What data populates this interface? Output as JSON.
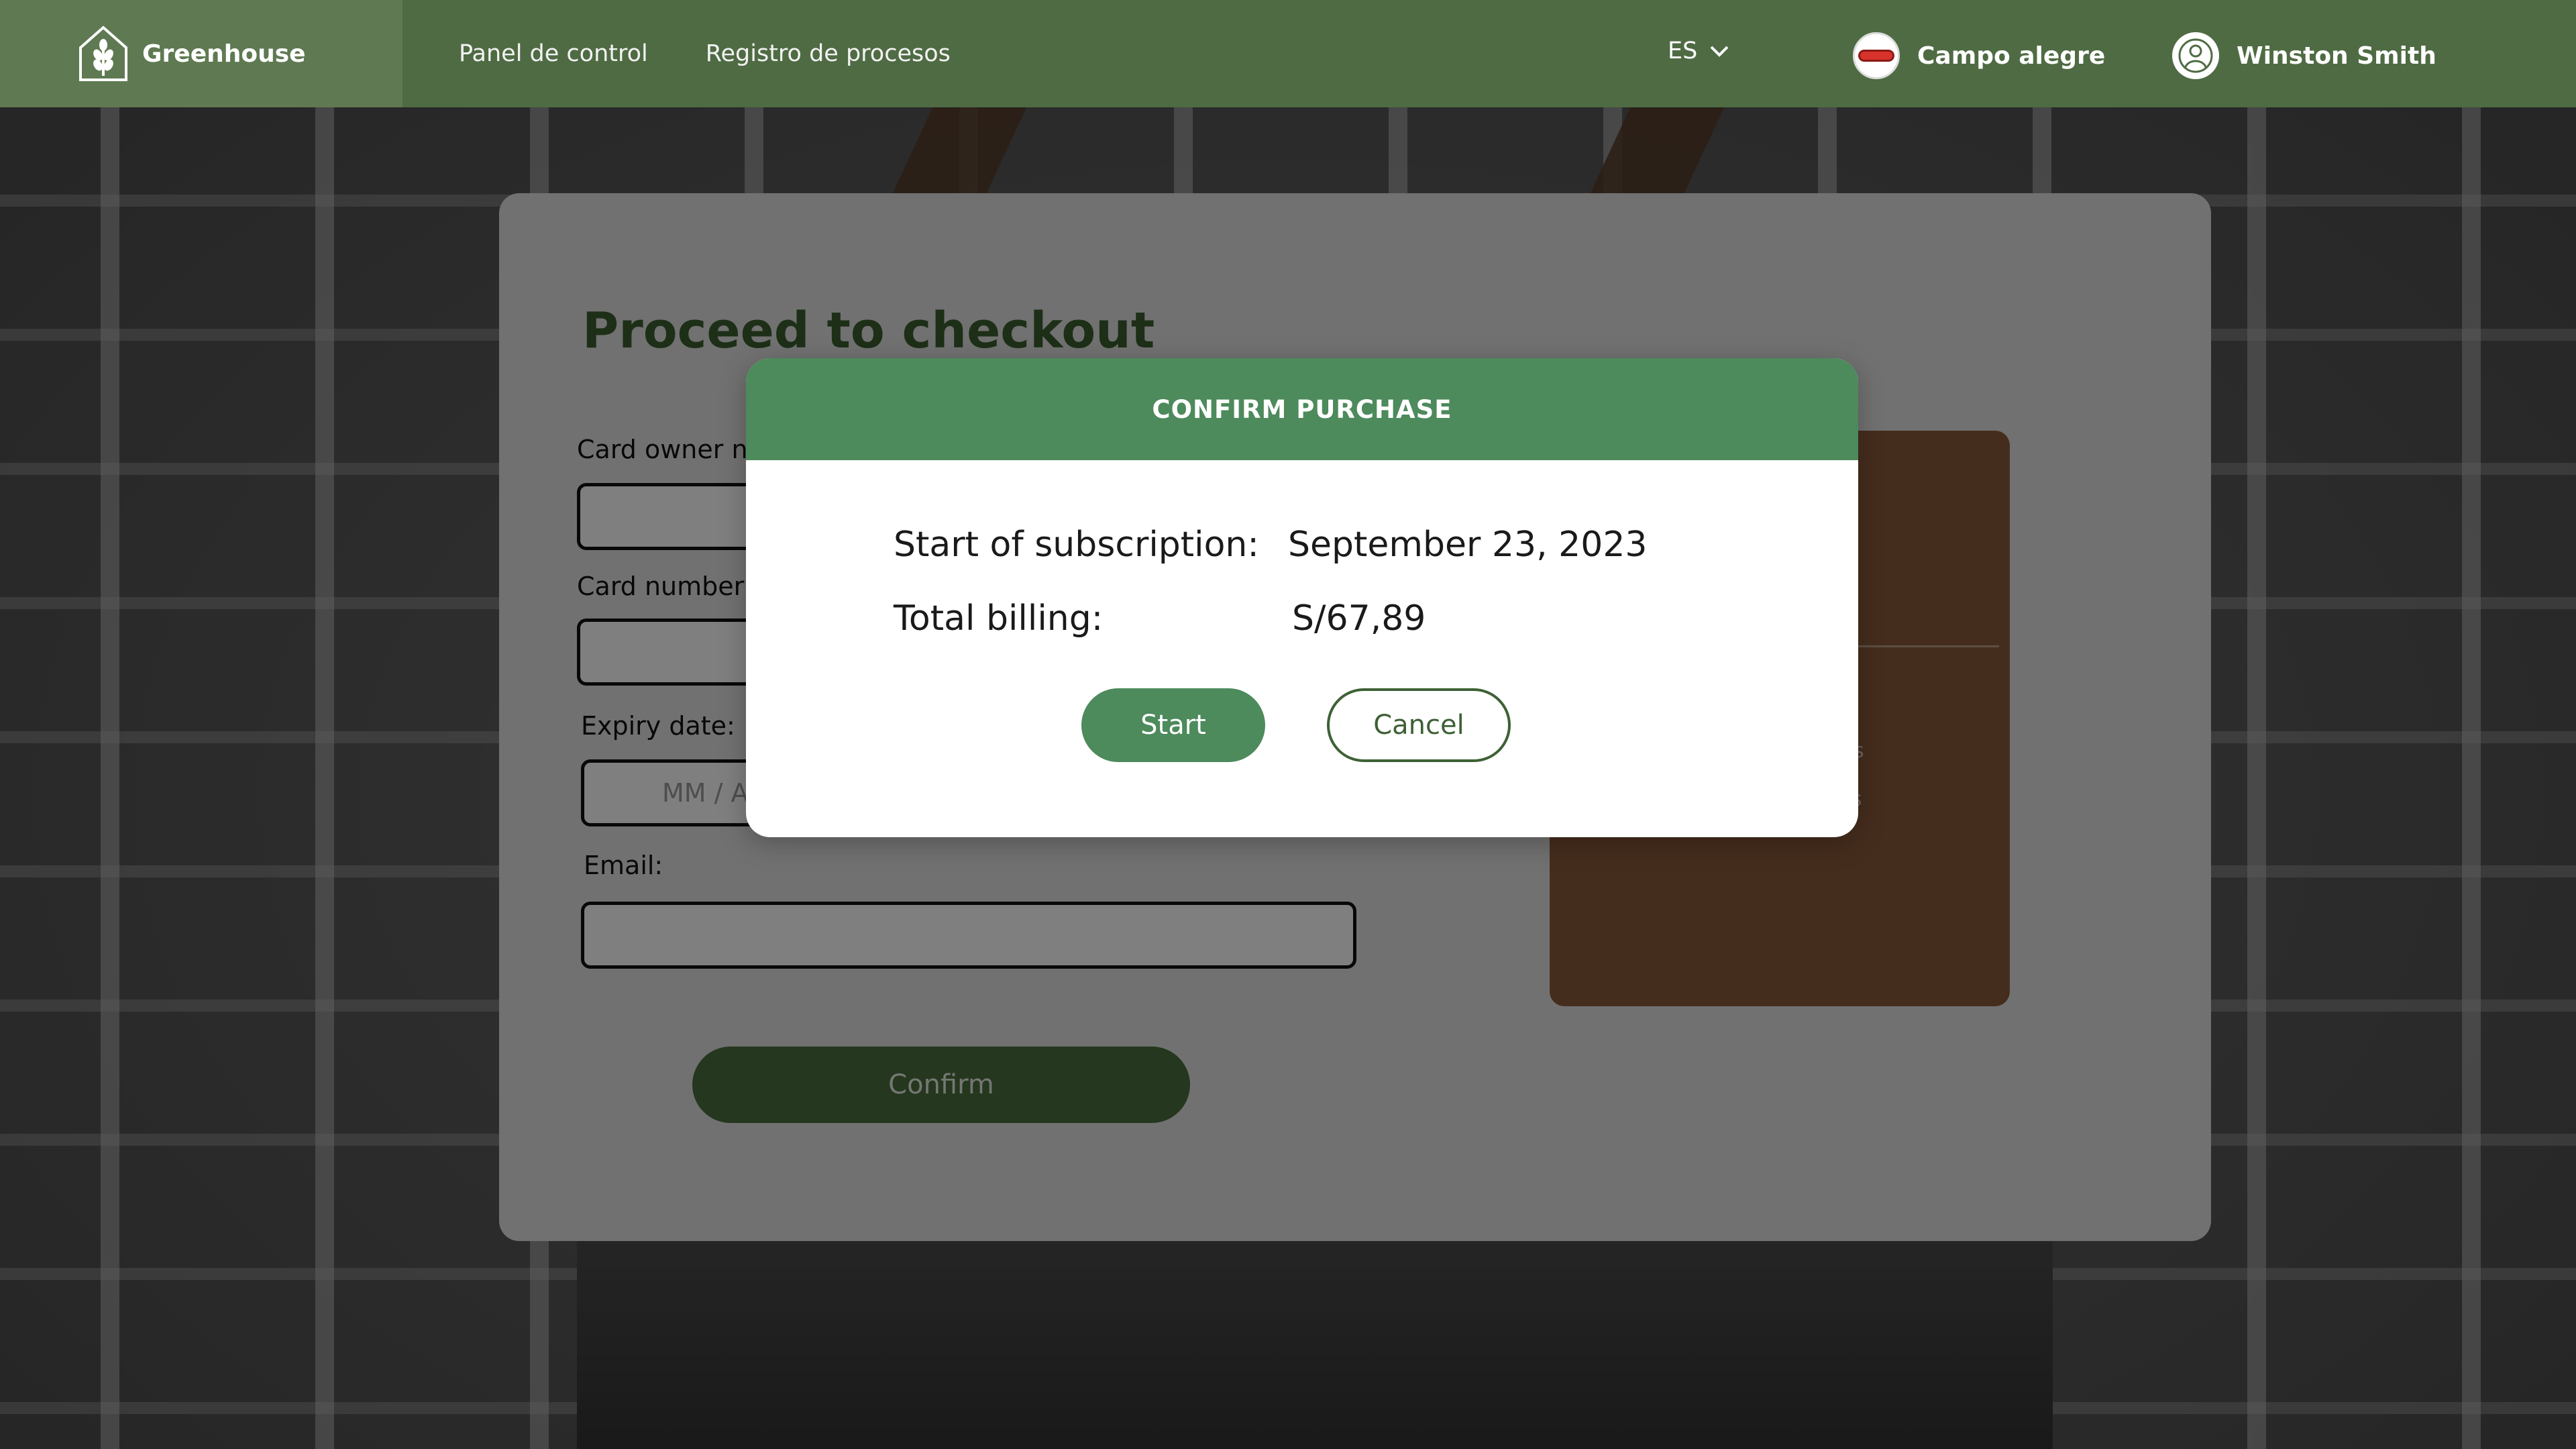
{
  "app": {
    "name": "Greenhouse"
  },
  "nav": {
    "links": [
      "Panel de control",
      "Registro de procesos"
    ],
    "language": "ES",
    "farm_name": "Campo alegre",
    "user_name": "Winston Smith"
  },
  "checkout": {
    "title": "Proceed to checkout",
    "card_owner_label": "Card owner na",
    "card_number_label": "Card number:",
    "expiry_label": "Expiry date:",
    "expiry_placeholder": "MM / A",
    "email_label": "Email:",
    "confirm_label": "Confirm",
    "plan_features": [
      "oyees",
      "ttings"
    ]
  },
  "modal": {
    "title": "CONFIRM PURCHASE",
    "start_label": "Start of subscription:",
    "start_value": "September 23, 2023",
    "billing_label": "Total billing:",
    "billing_value": "S/67,89",
    "start_button": "Start",
    "cancel_button": "Cancel"
  },
  "colors": {
    "topbar": "#4f6b43",
    "brand_block": "#5f7a52",
    "modal_header": "#4d8a5c",
    "title_green": "#3b5e2f",
    "plan_card": "#8a5a3a"
  }
}
